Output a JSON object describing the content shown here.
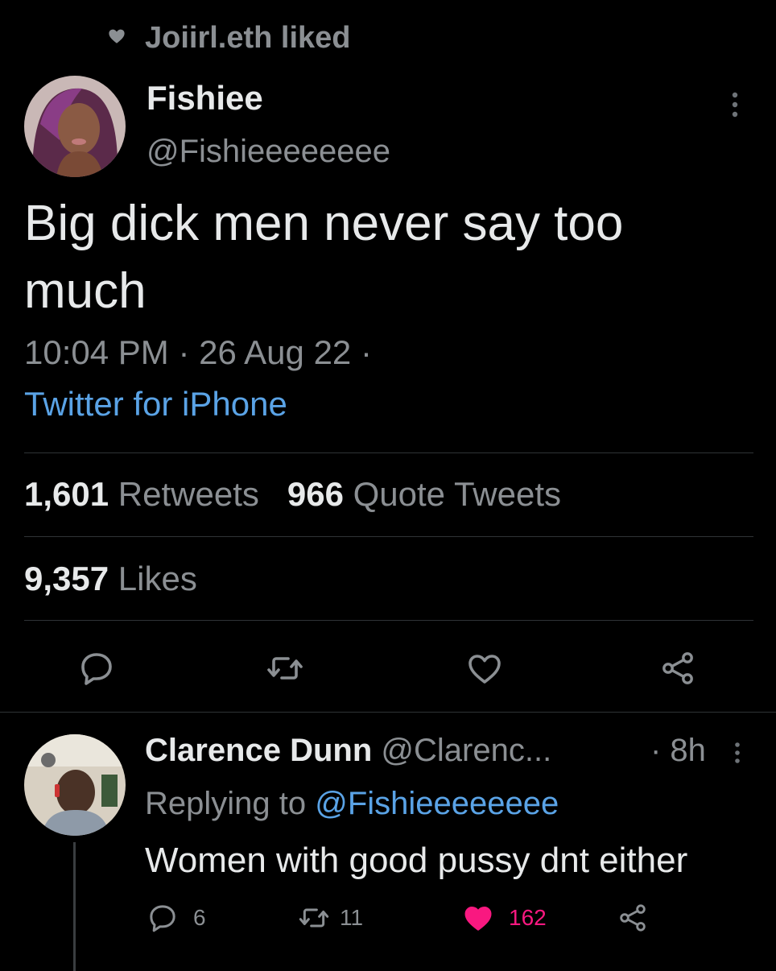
{
  "social_context": {
    "text": "Joiirl.eth liked",
    "icon": "heart-icon"
  },
  "tweet": {
    "author_name": "Fishiee",
    "author_handle": "@Fishieeeeeeee",
    "text": "Big dick men never say too much",
    "meta": "10:04 PM · 26 Aug 22 ·",
    "client": "Twitter for iPhone",
    "retweets_count": "1,601",
    "retweets_label": "Retweets",
    "quotes_count": "966",
    "quotes_label": "Quote Tweets",
    "likes_count": "9,357",
    "likes_label": "Likes",
    "actions": [
      "reply-icon",
      "retweet-icon",
      "like-icon",
      "share-icon"
    ]
  },
  "reply": {
    "author_name": "Clarence Dunn",
    "author_handle": "@Clarenc...",
    "time": "· 8h",
    "replying_prefix": "Replying to",
    "replying_handle": "@Fishieeeeeeee",
    "text": "Women with good pussy dnt either",
    "reply_count": "6",
    "retweet_count": "11",
    "like_count": "162",
    "liked": true
  },
  "colors": {
    "background": "#000000",
    "text": "#e7e9ea",
    "muted": "#8b8f93",
    "link": "#5aa3e6",
    "like": "#f91880",
    "divider": "#2f3336"
  }
}
